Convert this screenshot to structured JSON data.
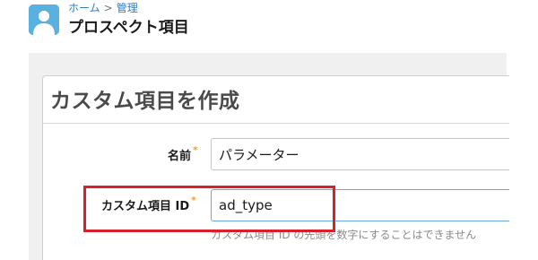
{
  "header": {
    "avatar_icon": "user-avatar-icon",
    "breadcrumb": {
      "home": "ホーム",
      "separator": ">",
      "current": "管理"
    },
    "title": "プロスペクト項目"
  },
  "card": {
    "title": "カスタム項目を作成",
    "fields": {
      "name": {
        "label": "名前",
        "required_mark": "*",
        "value": "パラメーター"
      },
      "custom_id": {
        "label": "カスタム項目 ID",
        "required_mark": "*",
        "value": "ad_type",
        "help": "カスタム項目 ID の先頭を数字にすることはできません"
      }
    }
  },
  "colors": {
    "accent": "#2f7cc0",
    "required": "#e8a23b",
    "highlight": "#d9202a",
    "avatar": "#5ab0de"
  }
}
